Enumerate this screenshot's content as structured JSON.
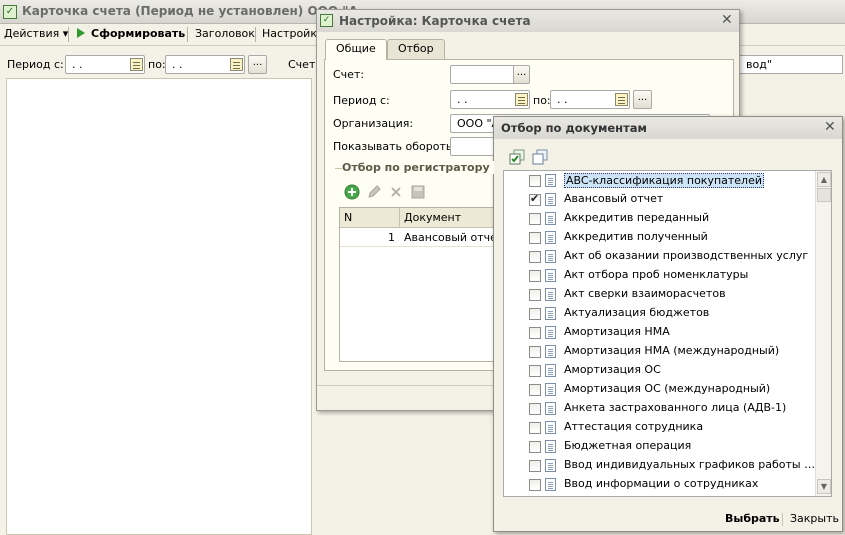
{
  "main": {
    "title": "Карточка счета  (Период не установлен) ООО \"А",
    "toolbar": {
      "actions": "Действия",
      "generate": "Сформировать",
      "heading": "Заголовок",
      "settings": "Настройка"
    },
    "period_label": "Период с:",
    "period_from": " .  .",
    "period_to_label": "по:",
    "period_to": " .  .",
    "account_label": "Счет:",
    "org_fragment": "вод\""
  },
  "settings": {
    "title": "Настройка: Карточка счета",
    "tabs": [
      "Общие",
      "Отбор"
    ],
    "account_label": "Счет:",
    "period_label": "Период с:",
    "period_from": " .  .",
    "period_to_label": "по:",
    "period_to": " .  .",
    "org_label": "Организация:",
    "org_value": "ООО \"А",
    "turnover_label": "Показывать обороты:",
    "group_title": "Отбор по регистратору",
    "grid": {
      "columns": [
        "N",
        "Документ"
      ],
      "rows": [
        {
          "n": "1",
          "doc": "Авансовый отчет"
        }
      ]
    }
  },
  "filter": {
    "title": "Отбор по документам",
    "items": [
      {
        "label": "ABC-классификация покупателей",
        "checked": false,
        "selected": true
      },
      {
        "label": "Авансовый отчет",
        "checked": true,
        "selected": false
      },
      {
        "label": "Аккредитив переданный",
        "checked": false,
        "selected": false
      },
      {
        "label": "Аккредитив полученный",
        "checked": false,
        "selected": false
      },
      {
        "label": "Акт об оказании производственных услуг",
        "checked": false,
        "selected": false
      },
      {
        "label": "Акт отбора проб номенклатуры",
        "checked": false,
        "selected": false
      },
      {
        "label": "Акт сверки взаиморасчетов",
        "checked": false,
        "selected": false
      },
      {
        "label": "Актуализация бюджетов",
        "checked": false,
        "selected": false
      },
      {
        "label": "Амортизация НМА",
        "checked": false,
        "selected": false
      },
      {
        "label": "Амортизация НМА (международный)",
        "checked": false,
        "selected": false
      },
      {
        "label": "Амортизация ОС",
        "checked": false,
        "selected": false
      },
      {
        "label": "Амортизация ОС (международный)",
        "checked": false,
        "selected": false
      },
      {
        "label": "Анкета застрахованного лица (АДВ-1)",
        "checked": false,
        "selected": false
      },
      {
        "label": "Аттестация сотрудника",
        "checked": false,
        "selected": false
      },
      {
        "label": "Бюджетная операция",
        "checked": false,
        "selected": false
      },
      {
        "label": "Ввод индивидуальных графиков работы орган...",
        "checked": false,
        "selected": false
      },
      {
        "label": "Ввод информации о сотрудниках",
        "checked": false,
        "selected": false
      }
    ],
    "select_button": "Выбрать",
    "close_button": "Закрыть"
  }
}
